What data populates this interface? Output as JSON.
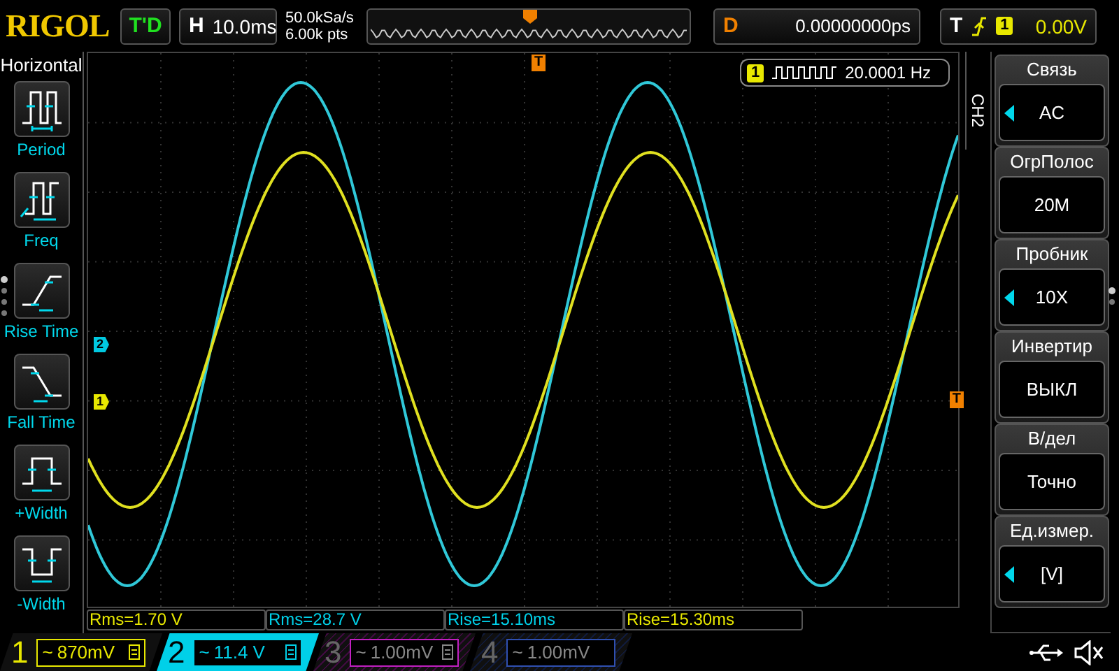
{
  "brand": "RIGOL",
  "run_state": "T'D",
  "timebase": {
    "label": "H",
    "value": "10.0ms"
  },
  "sample": {
    "rate": "50.0kSa/s",
    "points": "6.00k pts"
  },
  "delay": {
    "label": "D",
    "value": "0.00000000ps"
  },
  "trigger": {
    "label": "T",
    "channel": "1",
    "level": "0.00V"
  },
  "left_menu": {
    "title": "Horizontal",
    "items": [
      {
        "label": "Period",
        "kind": "period"
      },
      {
        "label": "Freq",
        "kind": "freq"
      },
      {
        "label": "Rise Time",
        "kind": "rise"
      },
      {
        "label": "Fall Time",
        "kind": "fall"
      },
      {
        "label": "+Width",
        "kind": "pwidth"
      },
      {
        "label": "-Width",
        "kind": "nwidth"
      }
    ]
  },
  "frequency_badge": {
    "channel": "1",
    "value": "20.0001 Hz"
  },
  "channel_markers": [
    {
      "label": "2",
      "color": "#00c8e0"
    },
    {
      "label": "1",
      "color": "#e8e800"
    }
  ],
  "trigger_position_marker": "T",
  "trigger_level_marker": "T",
  "right_menu": {
    "channel": "CH2",
    "items": [
      {
        "title": "Связь",
        "value": "AC",
        "arrow": true
      },
      {
        "title": "ОгрПолос",
        "value": "20M",
        "arrow": false
      },
      {
        "title": "Пробник",
        "value": "10X",
        "arrow": true
      },
      {
        "title": "Инвертир",
        "value": "ВЫКЛ",
        "arrow": false
      },
      {
        "title": "В/дел",
        "value": "Точно",
        "arrow": false
      },
      {
        "title": "Ед.измер.",
        "value": "[V]",
        "arrow": true
      }
    ]
  },
  "measurements": [
    {
      "text": "Rms=1.70 V",
      "color": "#e8e800"
    },
    {
      "text": "Rms=28.7 V",
      "color": "#00d0e8"
    },
    {
      "text": "Rise=15.10ms",
      "color": "#00d0e8"
    },
    {
      "text": "Rise=15.30ms",
      "color": "#e8e800"
    }
  ],
  "channels": [
    {
      "number": "1",
      "coupling": "~",
      "scale": "870mV",
      "color": "#e8e800",
      "on": true,
      "selected": false,
      "bw_limit": true
    },
    {
      "number": "2",
      "coupling": "~",
      "scale": "11.4 V",
      "color": "#00d0e8",
      "on": true,
      "selected": true,
      "bw_limit": true
    },
    {
      "number": "3",
      "coupling": "~",
      "scale": "1.00mV",
      "color": "#c020c0",
      "on": false,
      "selected": false,
      "bw_limit": true
    },
    {
      "number": "4",
      "coupling": "~",
      "scale": "1.00mV",
      "color": "#3050b0",
      "on": false,
      "selected": false,
      "bw_limit": false
    }
  ]
}
